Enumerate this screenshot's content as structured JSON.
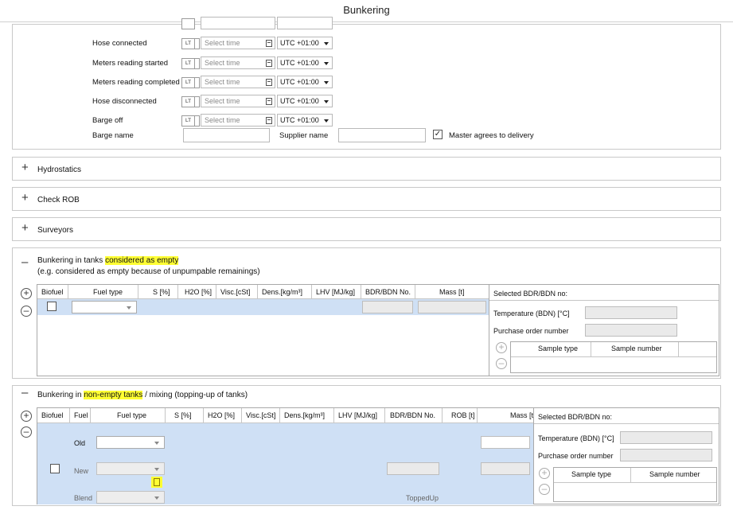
{
  "window": {
    "title": "Bunkering"
  },
  "events": {
    "rows": [
      {
        "label": "Hose connected",
        "lt": "LT",
        "time_placeholder": "Select time",
        "tz": "UTC +01:00"
      },
      {
        "label": "Meters reading started",
        "lt": "LT",
        "time_placeholder": "Select time",
        "tz": "UTC +01:00"
      },
      {
        "label": "Meters reading completed",
        "lt": "LT",
        "time_placeholder": "Select time",
        "tz": "UTC +01:00"
      },
      {
        "label": "Hose disconnected",
        "lt": "LT",
        "time_placeholder": "Select time",
        "tz": "UTC +01:00"
      },
      {
        "label": "Barge off",
        "lt": "LT",
        "time_placeholder": "Select time",
        "tz": "UTC +01:00"
      }
    ],
    "barge_name_label": "Barge name",
    "barge_name_value": "",
    "supplier_name_label": "Supplier name",
    "supplier_name_value": "",
    "master_agrees_label": "Master agrees to delivery",
    "master_agrees_checked": "✓"
  },
  "sections": {
    "hydrostatics": {
      "icon": "+",
      "title": "Hydrostatics"
    },
    "check_rob": {
      "icon": "+",
      "title": "Check ROB"
    },
    "surveyors": {
      "icon": "+",
      "title": "Surveyors"
    }
  },
  "empty_tanks": {
    "icon": "–",
    "title_prefix": "Bunkering in tanks ",
    "title_highlight": "considered as empty",
    "subtitle": "(e.g. considered as empty because of unpumpable remainings)",
    "columns": [
      "Biofuel",
      "Fuel type",
      "S [%]",
      "H2O [%]",
      "Visc.[cSt]",
      "Dens.[kg/m³]",
      "LHV [MJ/kg]",
      "BDR/BDN No.",
      "Mass [t]"
    ],
    "side": {
      "selected_label": "Selected BDR/BDN no:",
      "temperature_label": "Temperature (BDN) [°C]",
      "purchase_label": "Purchase order number",
      "sample_columns": [
        "Sample type",
        "Sample number"
      ]
    }
  },
  "nonempty_tanks": {
    "icon": "–",
    "title_prefix": "Bunkering in ",
    "title_highlight": "non-empty tanks",
    "title_suffix": " / mixing (topping-up of tanks)",
    "columns": [
      "Biofuel",
      "Fuel",
      "Fuel type",
      "S [%]",
      "H2O [%]",
      "Visc.[cSt]",
      "Dens.[kg/m³]",
      "LHV [MJ/kg]",
      "BDR/BDN No.",
      "ROB [t]",
      "Mass [t]"
    ],
    "rows": {
      "old": "Old",
      "new": "New",
      "blend": "Blend",
      "topped_up": "ToppedUp"
    },
    "side": {
      "selected_label": "Selected BDR/BDN no:",
      "temperature_label": "Temperature (BDN) [°C]",
      "purchase_label": "Purchase order number",
      "sample_columns": [
        "Sample type",
        "Sample number"
      ]
    }
  },
  "controls": {
    "add": "+",
    "remove": "–"
  },
  "colors": {
    "highlight": "#ffff33",
    "row_selected": "#cfe0f5"
  }
}
